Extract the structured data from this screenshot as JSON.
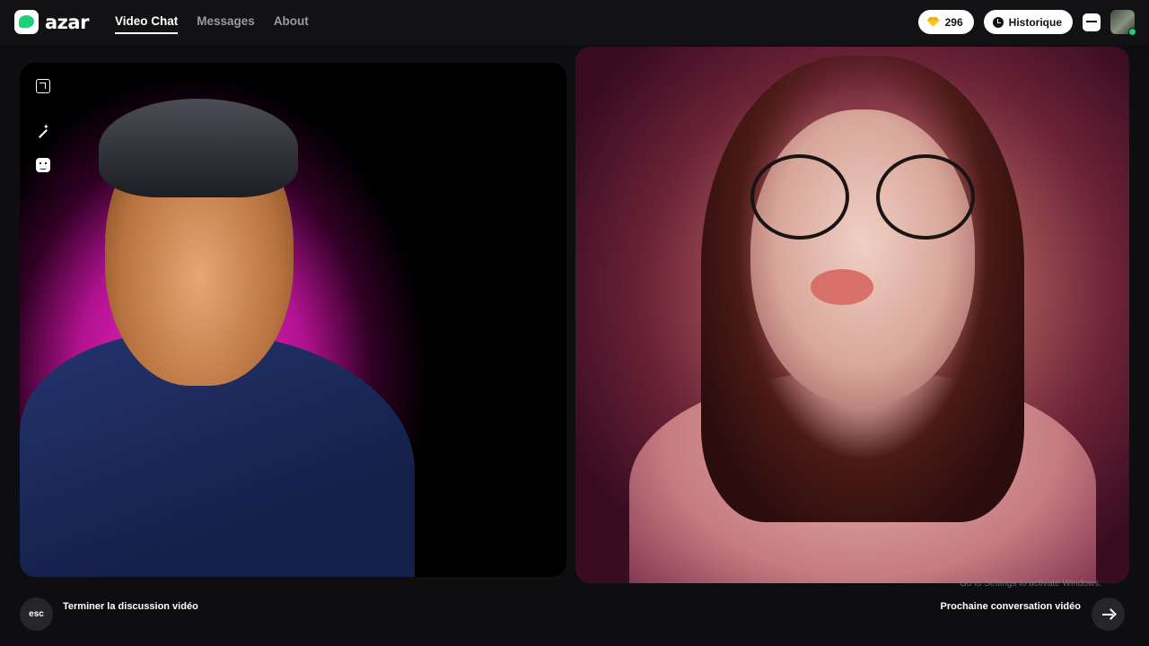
{
  "app": {
    "brand": "azar"
  },
  "nav": {
    "items": [
      {
        "label": "Video Chat",
        "active": true
      },
      {
        "label": "Messages",
        "active": false
      },
      {
        "label": "About",
        "active": false
      }
    ]
  },
  "header": {
    "gems_count": "296",
    "history_label": "Historique"
  },
  "video": {
    "tools": [
      "minimize-icon",
      "magic-wand-icon",
      "face-filter-icon"
    ]
  },
  "footer": {
    "esc_label": "esc",
    "end_label": "Terminer la discussion vidéo",
    "next_label": "Prochaine conversation vidéo",
    "activation_watermark": "Go to Settings to activate Windows."
  },
  "colors": {
    "accent": "#1fd07a",
    "gem": "#ffc928",
    "background": "#0e0e10",
    "glow": "#ff2bd1"
  }
}
